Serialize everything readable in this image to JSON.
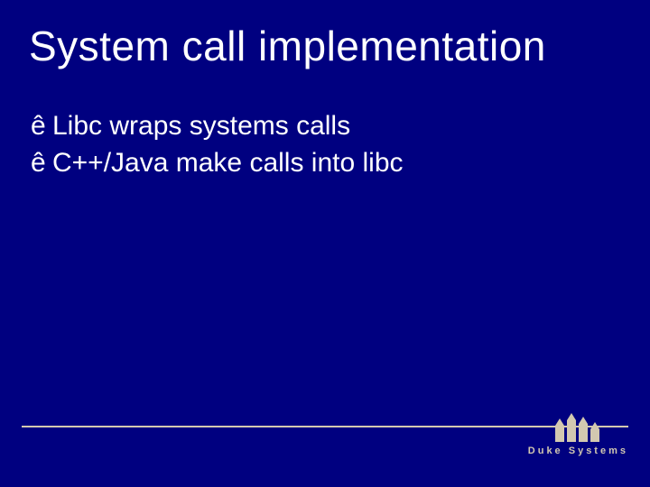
{
  "title": "System call implementation",
  "bullet_marker": "ê",
  "bullets": [
    "Libc wraps systems calls",
    "C++/Java make calls into libc"
  ],
  "footer": {
    "brand": "Duke Systems"
  }
}
